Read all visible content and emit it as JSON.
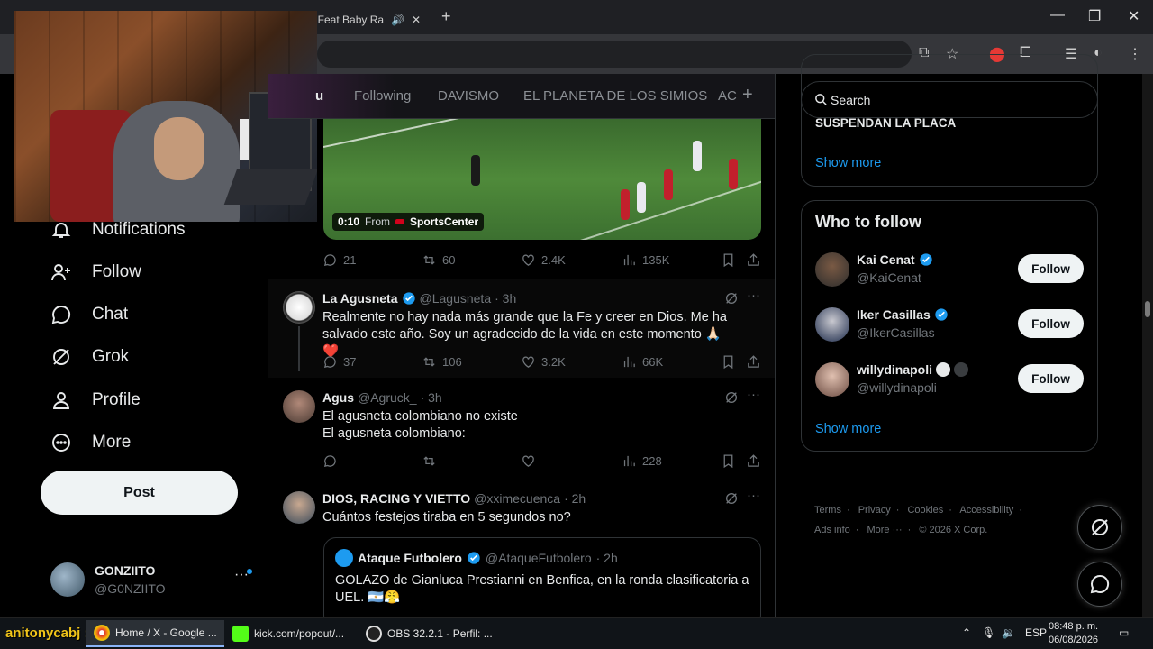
{
  "browser": {
    "tab_title": "ni Feat Baby Ra",
    "tab_close": "✕",
    "new_tab": "+",
    "minimize": "—",
    "maximize": "❐",
    "close": "✕"
  },
  "nav": {
    "items": [
      {
        "label": "Notifications",
        "icon": "bell-icon"
      },
      {
        "label": "Follow",
        "icon": "follow-icon"
      },
      {
        "label": "Chat",
        "icon": "chat-icon"
      },
      {
        "label": "Grok",
        "icon": "grok-icon"
      },
      {
        "label": "Profile",
        "icon": "profile-icon"
      },
      {
        "label": "More",
        "icon": "more-circle-icon"
      }
    ],
    "post_label": "Post",
    "account": {
      "name": "GONZIITO",
      "handle": "@G0NZIITO",
      "more": "···"
    }
  },
  "timeline": {
    "tabs": [
      {
        "label": "u",
        "active": true
      },
      {
        "label": "Following",
        "active": false
      },
      {
        "label": "DAVISMO",
        "active": false
      },
      {
        "label": "EL PLANETA DE LOS SIMIOS",
        "active": false
      },
      {
        "label": "AC",
        "active": false
      }
    ],
    "add_tab": "+",
    "video": {
      "time": "0:10",
      "from": "From",
      "source": "SportsCenter"
    },
    "video_stats": {
      "replies": "21",
      "reposts": "60",
      "likes": "2.4K",
      "views": "135K"
    },
    "tweets": [
      {
        "name": "La Agusneta",
        "handle": "@Lagusneta",
        "time": "· 3h",
        "text": "Realmente no hay nada más grande que la Fe y creer en Dios. Me ha salvado este año. Soy un agradecido de la vida en este momento 🙏🏻❤️",
        "replies": "37",
        "reposts": "106",
        "likes": "3.2K",
        "views": "66K"
      },
      {
        "name": "Agus",
        "handle": "@Agruck_",
        "time": "· 3h",
        "text_line1": "El agusneta colombiano no existe",
        "text_line2": "El agusneta colombiano:",
        "replies": "",
        "reposts": "",
        "likes": "",
        "views": "228"
      },
      {
        "name": "DIOS, RACING Y VIETTO",
        "handle": "@xximecuenca",
        "time": "· 2h",
        "text": "Cuántos festejos tiraba en 5 segundos no?",
        "quote": {
          "name": "Ataque Futbolero",
          "handle": "@AtaqueFutbolero",
          "time": "· 2h",
          "text": "GOLAZO de Gianluca Prestianni en Benfica, en la ronda clasificatoria a UEL. 🇦🇷😤"
        }
      }
    ]
  },
  "sidebar": {
    "search_placeholder": "Search",
    "trend_partial": "SUSPENDAN LA PLACA",
    "show_more": "Show more",
    "who_to_follow_title": "Who to follow",
    "suggestions": [
      {
        "name": "Kai Cenat",
        "handle": "@KaiCenat",
        "button": "Follow"
      },
      {
        "name": "Iker Casillas",
        "handle": "@IkerCasillas",
        "button": "Follow"
      },
      {
        "name": "willydinapoli",
        "handle": "@willydinapoli",
        "button": "Follow"
      }
    ],
    "show_more_2": "Show more",
    "footer": {
      "terms": "Terms",
      "privacy": "Privacy",
      "cookies": "Cookies",
      "accessibility": "Accessibility",
      "ads": "Ads info",
      "more": "More ···",
      "copyright": "© 2026 X Corp."
    }
  },
  "taskbar": {
    "streamer": "anitonycabj :",
    "items": [
      {
        "label": "Home / X - Google ..."
      },
      {
        "label": "kick.com/popout/..."
      },
      {
        "label": "OBS 32.2.1 - Perfil: ..."
      }
    ],
    "lang": "ESP",
    "time": "08:48 p. m.",
    "date": "06/08/2026"
  },
  "colors": {
    "accent": "#1d9bf0",
    "background": "#000000",
    "text": "#e7e9ea",
    "muted": "#71767b",
    "like_heart": "#f91880"
  }
}
